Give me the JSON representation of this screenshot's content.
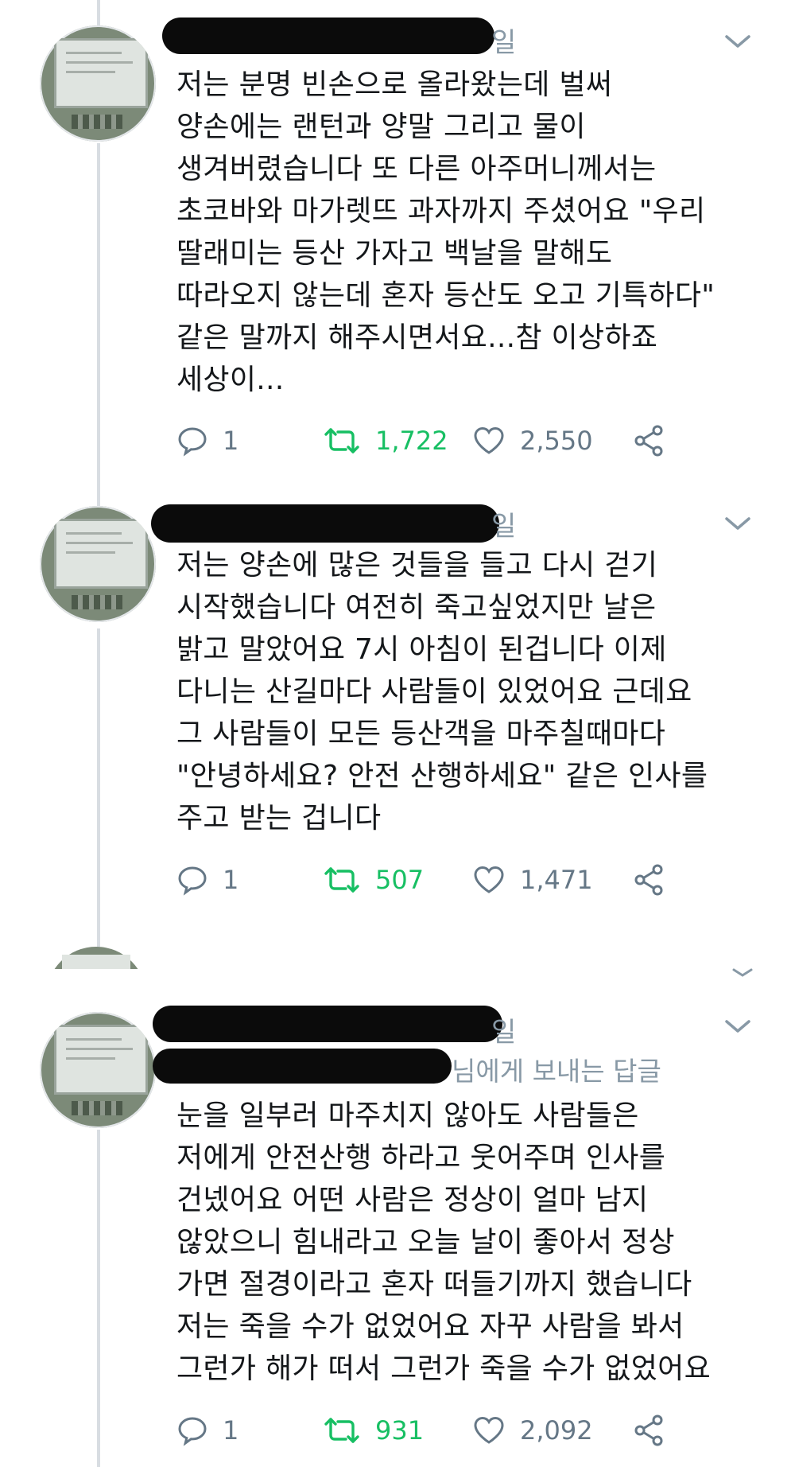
{
  "tweets": [
    {
      "meta_tail": "일",
      "reply_to": "",
      "lines": [
        "저는 분명 빈손으로 올라왔는데 벌써",
        "양손에는 랜턴과 양말 그리고 물이",
        "생겨버렸습니다 또 다른 아주머니께서는",
        "초코바와 마가렛뜨 과자까지 주셨어요 \"우리",
        "딸래미는 등산 가자고 백날을 말해도",
        "따라오지 않는데 혼자 등산도 오고 기특하다\"",
        "같은 말까지 해주시면서요...참 이상하죠",
        "세상이..."
      ],
      "replies": "1",
      "retweets": "1,722",
      "likes": "2,550"
    },
    {
      "meta_tail": "일",
      "reply_to": "",
      "lines": [
        "저는 양손에 많은 것들을 들고 다시 걷기",
        "시작했습니다 여전히 죽고싶었지만 날은",
        "밝고 말았어요 7시 아침이 된겁니다 이제",
        "다니는 산길마다 사람들이 있었어요 근데요",
        "그 사람들이 모든 등산객을 마주칠때마다",
        "\"안녕하세요? 안전 산행하세요\" 같은 인사를",
        "주고 받는 겁니다"
      ],
      "replies": "1",
      "retweets": "507",
      "likes": "1,471"
    },
    {
      "meta_tail": "일",
      "reply_to": "님에게 보내는 답글",
      "lines": [
        "눈을 일부러 마주치지 않아도 사람들은",
        "저에게 안전산행 하라고 웃어주며 인사를",
        "건넸어요 어떤 사람은 정상이 얼마 남지",
        "않았으니 힘내라고 오늘 날이 좋아서 정상",
        "가면 절경이라고 혼자 떠들기까지 했습니다",
        "저는 죽을 수가 없었어요 자꾸 사람을 봐서",
        "그런가 해가 떠서 그런가 죽을 수가 없었어요"
      ],
      "replies": "1",
      "retweets": "931",
      "likes": "2,092"
    }
  ],
  "icons": {
    "reply": "reply-icon",
    "retweet": "retweet-icon",
    "like": "heart-icon",
    "share": "share-icon",
    "menu": "chevron-down-icon"
  },
  "colors": {
    "retweet_active": "#17bf63",
    "muted": "#657786",
    "thread_line": "#d8dde2",
    "text": "#14171a"
  }
}
